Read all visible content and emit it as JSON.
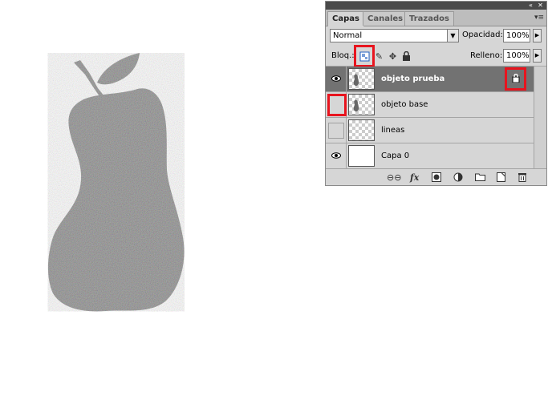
{
  "panel": {
    "titlebar": {
      "collapse_icon": "«",
      "close_icon": "✕"
    },
    "tabs": [
      {
        "label": "Capas",
        "active": true
      },
      {
        "label": "Canales",
        "active": false
      },
      {
        "label": "Trazados",
        "active": false
      }
    ],
    "blend_mode": "Normal",
    "opacity_label": "Opacidad:",
    "opacity_value": "100%",
    "lock_label": "Bloq.:",
    "fill_label": "Relleno:",
    "fill_value": "100%",
    "layers": [
      {
        "name": "objeto prueba",
        "visible": true,
        "selected": true,
        "locked": true
      },
      {
        "name": "objeto base",
        "visible": false,
        "selected": false,
        "locked": false
      },
      {
        "name": "lineas",
        "visible": false,
        "selected": false,
        "locked": false
      },
      {
        "name": "Capa 0",
        "visible": true,
        "selected": false,
        "locked": false
      }
    ],
    "bottom_icons": [
      "link-icon",
      "fx-icon",
      "mask-icon",
      "adjustment-icon",
      "folder-icon",
      "new-layer-icon",
      "trash-icon"
    ],
    "highlight_color": "#e8141e",
    "selected_color": "#727272"
  },
  "canvas": {
    "subject": "pear-shape-noise"
  }
}
